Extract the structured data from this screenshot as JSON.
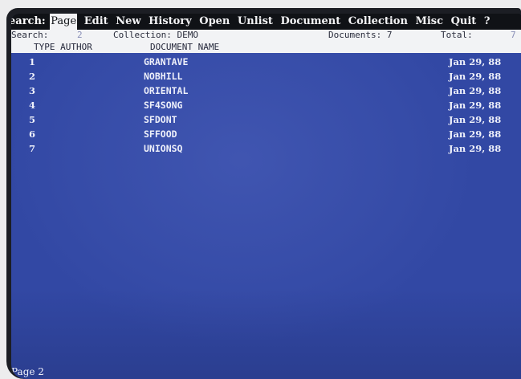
{
  "menu": {
    "active_label": "earch:",
    "highlighted_item": "Page",
    "items": [
      "Edit",
      "New",
      "History",
      "Open",
      "Unlist",
      "Document",
      "Collection",
      "Misc",
      "Quit",
      "?"
    ]
  },
  "status": {
    "search_label": "Search:",
    "search_value": "2",
    "collection_text": "Collection: DEMO",
    "documents_text": "Documents: 7",
    "total_label": "Total:",
    "total_value": "7"
  },
  "columns": {
    "type_author": "TYPE AUTHOR",
    "document_name": "DOCUMENT NAME"
  },
  "rows": [
    {
      "num": "1",
      "name": "GRANTAVE",
      "date": "Jan 29, 88"
    },
    {
      "num": "2",
      "name": "NOBHILL",
      "date": "Jan 29, 88"
    },
    {
      "num": "3",
      "name": "ORIENTAL",
      "date": "Jan 29, 88"
    },
    {
      "num": "4",
      "name": "SF4SONG",
      "date": "Jan 29, 88"
    },
    {
      "num": "5",
      "name": "SFDONT",
      "date": "Jan 29, 88"
    },
    {
      "num": "6",
      "name": "SFFOOD",
      "date": "Jan 29, 88"
    },
    {
      "num": "7",
      "name": "UNIONSQ",
      "date": "Jan 29, 88"
    }
  ],
  "footer": {
    "page_text": "Page 2"
  }
}
